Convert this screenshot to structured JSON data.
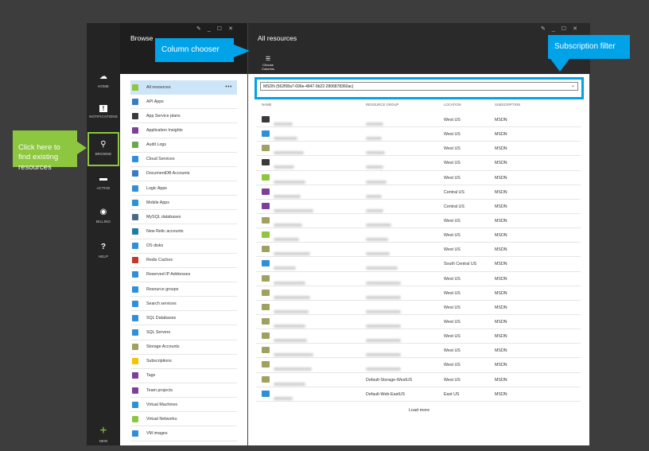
{
  "nav": {
    "items": [
      {
        "label": "HOME",
        "icon": "cloud-icon",
        "glyph": "☁"
      },
      {
        "label": "NOTIFICATIONS",
        "icon": "notification-icon",
        "glyph": "!"
      },
      {
        "label": "BROWSE",
        "icon": "browse-icon",
        "glyph": "⚲"
      },
      {
        "label": "ACTIVE",
        "icon": "active-icon",
        "glyph": "▬"
      },
      {
        "label": "BILLING",
        "icon": "billing-icon",
        "glyph": "◉"
      },
      {
        "label": "HELP",
        "icon": "help-icon",
        "glyph": "?"
      },
      {
        "label": "NEW",
        "icon": "plus-icon",
        "glyph": "+"
      }
    ]
  },
  "browse": {
    "title": "Browse",
    "more": "•••",
    "items": [
      {
        "label": "All resources",
        "color": "#8dc63f"
      },
      {
        "label": "API Apps",
        "color": "#3a7cc2"
      },
      {
        "label": "App Service plans",
        "color": "#3a3a3a"
      },
      {
        "label": "Application Insights",
        "color": "#7d3f98"
      },
      {
        "label": "Audit Logs",
        "color": "#6aa84f"
      },
      {
        "label": "Cloud Services",
        "color": "#2f8fd8"
      },
      {
        "label": "DocumentDB Accounts",
        "color": "#3a7cc2"
      },
      {
        "label": "Logic Apps",
        "color": "#2f8fd8"
      },
      {
        "label": "Mobile Apps",
        "color": "#2f8fd8"
      },
      {
        "label": "MySQL databases",
        "color": "#4b6a88"
      },
      {
        "label": "New Relic accounts",
        "color": "#1a7fa0"
      },
      {
        "label": "OS disks",
        "color": "#2f8fd8"
      },
      {
        "label": "Redis Caches",
        "color": "#c0392b"
      },
      {
        "label": "Reserved IP Addresses",
        "color": "#2f8fd8"
      },
      {
        "label": "Resource groups",
        "color": "#2f8fd8"
      },
      {
        "label": "Search services",
        "color": "#2f8fd8"
      },
      {
        "label": "SQL Databases",
        "color": "#2f8fd8"
      },
      {
        "label": "SQL Servers",
        "color": "#2f8fd8"
      },
      {
        "label": "Storage Accounts",
        "color": "#a0a060"
      },
      {
        "label": "Subscriptions",
        "color": "#f5c400"
      },
      {
        "label": "Tags",
        "color": "#7d3f98"
      },
      {
        "label": "Team projects",
        "color": "#7d3f98"
      },
      {
        "label": "Virtual Machines",
        "color": "#2f8fd8"
      },
      {
        "label": "Virtual Networks",
        "color": "#8dc63f"
      },
      {
        "label": "VM images",
        "color": "#2f8fd8"
      }
    ]
  },
  "resources": {
    "title": "All resources",
    "choose_columns": "Choose\nColumns",
    "subscription": "MSDN (562f08a7-696e-4847-9b22-2806878360ac)",
    "columns": {
      "name": "NAME",
      "group": "RESOURCE GROUP",
      "location": "LOCATION",
      "subscription": "SUBSCRIPTION"
    },
    "rows": [
      {
        "icon": "#3a3a3a",
        "group": "",
        "location": "West US",
        "subscription": "MSDN"
      },
      {
        "icon": "#2f8fd8",
        "group": "",
        "location": "West US",
        "subscription": "MSDN"
      },
      {
        "icon": "#a0a060",
        "group": "",
        "location": "West US",
        "subscription": "MSDN"
      },
      {
        "icon": "#3a3a3a",
        "group": "",
        "location": "West US",
        "subscription": "MSDN"
      },
      {
        "icon": "#8dc63f",
        "group": "",
        "location": "West US",
        "subscription": "MSDN"
      },
      {
        "icon": "#7d3f98",
        "group": "",
        "location": "Central US",
        "subscription": "MSDN"
      },
      {
        "icon": "#7d3f98",
        "group": "",
        "location": "Central US",
        "subscription": "MSDN"
      },
      {
        "icon": "#a0a060",
        "group": "",
        "location": "West US",
        "subscription": "MSDN"
      },
      {
        "icon": "#8dc63f",
        "group": "",
        "location": "West US",
        "subscription": "MSDN"
      },
      {
        "icon": "#a0a060",
        "group": "",
        "location": "West US",
        "subscription": "MSDN"
      },
      {
        "icon": "#2f8fd8",
        "group": "",
        "location": "South Central US",
        "subscription": "MSDN"
      },
      {
        "icon": "#a0a060",
        "group": "",
        "location": "West US",
        "subscription": "MSDN"
      },
      {
        "icon": "#a0a060",
        "group": "",
        "location": "West US",
        "subscription": "MSDN"
      },
      {
        "icon": "#a0a060",
        "group": "",
        "location": "West US",
        "subscription": "MSDN"
      },
      {
        "icon": "#a0a060",
        "group": "",
        "location": "West US",
        "subscription": "MSDN"
      },
      {
        "icon": "#a0a060",
        "group": "",
        "location": "West US",
        "subscription": "MSDN"
      },
      {
        "icon": "#a0a060",
        "group": "",
        "location": "West US",
        "subscription": "MSDN"
      },
      {
        "icon": "#a0a060",
        "group": "",
        "location": "West US",
        "subscription": "MSDN"
      },
      {
        "icon": "#a0a060",
        "group": "Default-Storage-WestUS",
        "location": "West US",
        "subscription": "MSDN"
      },
      {
        "icon": "#2f8fd8",
        "group": "Default-Web-EastUS",
        "location": "East US",
        "subscription": "MSDN"
      }
    ],
    "load_more": "Load more"
  },
  "callouts": {
    "column_chooser": "Column chooser",
    "subscription_filter": "Subscription filter",
    "browse_hint": "Click here to\nfind  existing\nresources"
  },
  "colors": {
    "accent_blue": "#00a2e8",
    "accent_green": "#8dc63f"
  }
}
